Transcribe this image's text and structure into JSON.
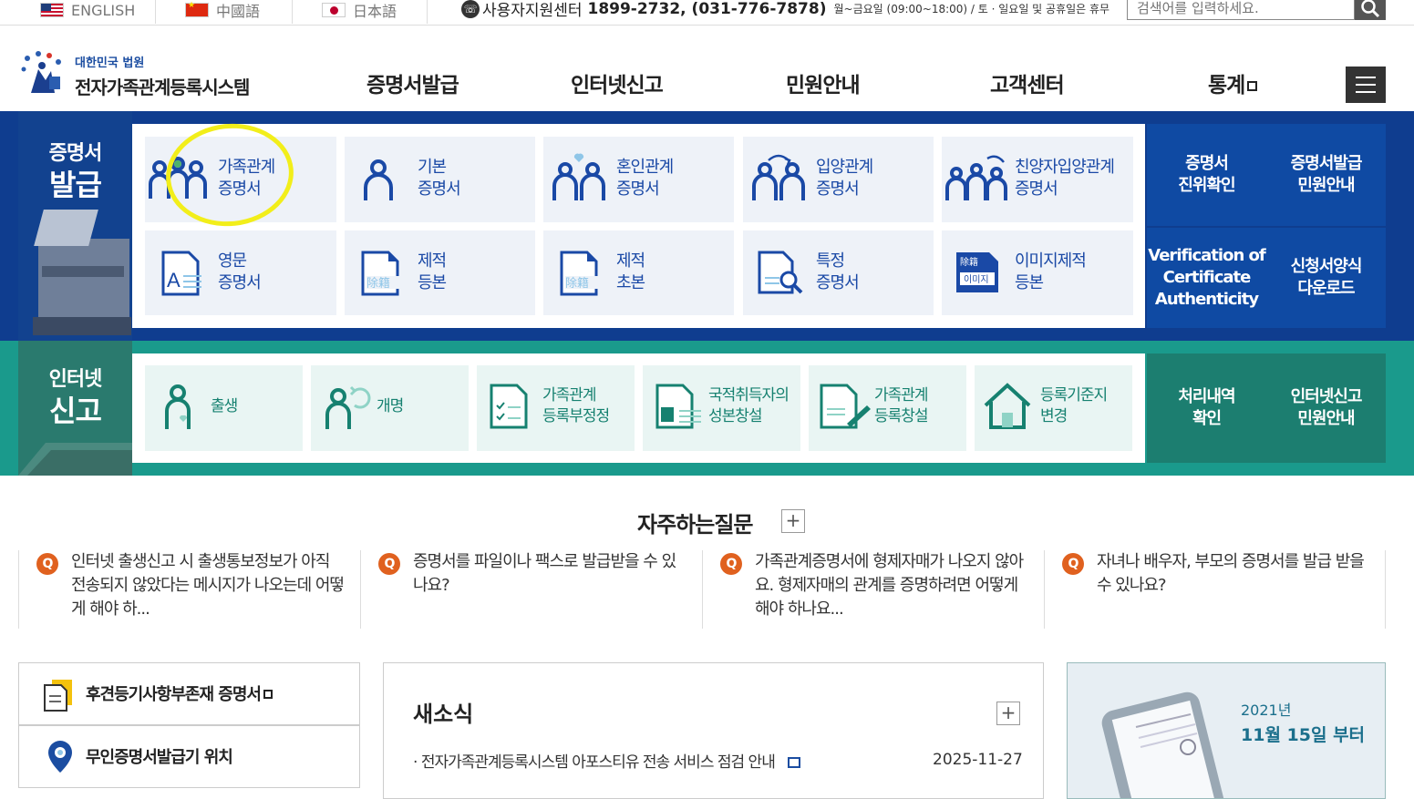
{
  "topbar": {
    "languages": [
      {
        "label": "ENGLISH"
      },
      {
        "label": "中國語"
      },
      {
        "label": "日本語"
      }
    ],
    "call_center_label": "사용자지원센터",
    "call_center_phone": "1899-2732, (031-776-7878)",
    "call_center_hours": "월~금요일 (09:00~18:00) / 토 · 일요일 및 공휴일은 휴무",
    "search_placeholder": "검색어를 입력하세요."
  },
  "header": {
    "logo_sub": "대한민국 법원",
    "logo_main": "전자가족관계등록시스템",
    "nav": [
      "증명서발급",
      "인터넷신고",
      "민원안내",
      "고객센터",
      "통계"
    ]
  },
  "certificates": {
    "title_line1": "증명서",
    "title_line2": "발급",
    "items": [
      {
        "line1": "가족관계",
        "line2": "증명서"
      },
      {
        "line1": "기본",
        "line2": "증명서"
      },
      {
        "line1": "혼인관계",
        "line2": "증명서"
      },
      {
        "line1": "입양관계",
        "line2": "증명서"
      },
      {
        "line1": "친양자입양관계",
        "line2": "증명서"
      },
      {
        "line1": "영문",
        "line2": "증명서"
      },
      {
        "line1": "제적",
        "line2": "등본"
      },
      {
        "line1": "제적",
        "line2": "초본"
      },
      {
        "line1": "특정",
        "line2": "증명서"
      },
      {
        "line1": "이미지제적",
        "line2": "등본"
      }
    ],
    "icon_text_jejeok": "除籍",
    "icon_text_image_top": "除籍",
    "icon_text_image_bottom": "이미지",
    "side": [
      {
        "line1": "증명서",
        "line2": "진위확인"
      },
      {
        "line1": "증명서발급",
        "line2": "민원안내"
      },
      {
        "line1": "Verification of",
        "line2": "Certificate",
        "line3": "Authenticity"
      },
      {
        "line1": "신청서양식",
        "line2": "다운로드"
      }
    ]
  },
  "reports": {
    "title_line1": "인터넷",
    "title_line2": "신고",
    "items": [
      {
        "line1": "출생",
        "line2": ""
      },
      {
        "line1": "개명",
        "line2": ""
      },
      {
        "line1": "가족관계",
        "line2": "등록부정정"
      },
      {
        "line1": "국적취득자의",
        "line2": "성본창설"
      },
      {
        "line1": "가족관계",
        "line2": "등록창설"
      },
      {
        "line1": "등록기준지",
        "line2": "변경"
      }
    ],
    "side": [
      {
        "line1": "처리내역",
        "line2": "확인"
      },
      {
        "line1": "인터넷신고",
        "line2": "민원안내"
      }
    ]
  },
  "faq": {
    "title": "자주하는질문",
    "items": [
      "인터넷 출생신고 시 출생통보정보가 아직 전송되지 않았다는 메시지가 나오는데 어떻게 해야 하...",
      "증명서를 파일이나 팩스로 발급받을 수 있나요?",
      "가족관계증명서에 형제자매가 나오지 않아요. 형제자매의 관계를 증명하려면 어떻게 해야 하나요...",
      "자녀나 배우자, 부모의 증명서를 발급 받을 수 있나요?"
    ]
  },
  "quick_links": [
    "후견등기사항부존재 증명서",
    "무인증명서발급기 위치"
  ],
  "news": {
    "title": "새소식",
    "item": "전자가족관계등록시스템 아포스티유 전송 서비스 점검 안내",
    "date": "2025-11-27"
  },
  "banner": {
    "year": "2021년",
    "date": "11월 15일 부터"
  },
  "colors": {
    "blue_band": "#0f3d8f",
    "green_band": "#1a9a8c",
    "highlight": "#f2ee1a"
  }
}
